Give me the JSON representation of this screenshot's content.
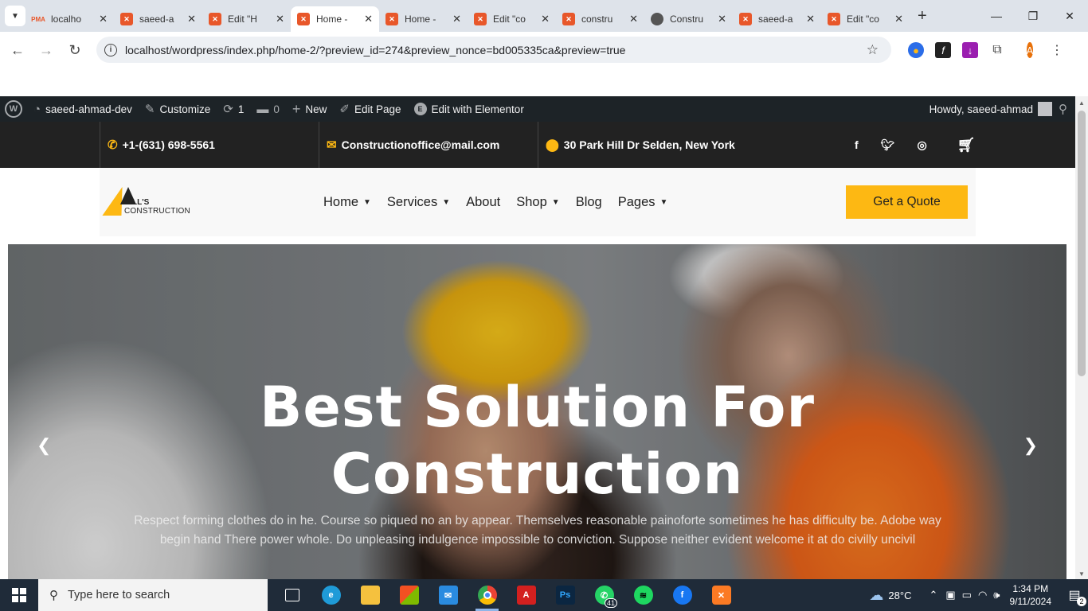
{
  "browser": {
    "tabs": [
      {
        "label": "localho",
        "icon": "phpmyadmin-icon",
        "active": false
      },
      {
        "label": "saeed-a",
        "icon": "elementor-icon",
        "active": false
      },
      {
        "label": "Edit \"H",
        "icon": "elementor-icon",
        "active": false
      },
      {
        "label": "Home -",
        "icon": "elementor-icon",
        "active": true
      },
      {
        "label": "Home -",
        "icon": "elementor-icon",
        "active": false
      },
      {
        "label": "Edit \"co",
        "icon": "elementor-icon",
        "active": false
      },
      {
        "label": "constru",
        "icon": "elementor-icon",
        "active": false
      },
      {
        "label": "Constru",
        "icon": "globe-icon",
        "active": false
      },
      {
        "label": "saeed-a",
        "icon": "elementor-icon",
        "active": false
      },
      {
        "label": "Edit \"co",
        "icon": "elementor-icon",
        "active": false
      }
    ],
    "url": "localhost/wordpress/index.php/home-2/?preview_id=274&preview_nonce=bd005335ca&preview=true",
    "profile_initial": "A"
  },
  "adminbar": {
    "site": "saeed-ahmad-dev",
    "customize": "Customize",
    "updates": "1",
    "comments": "0",
    "new": "New",
    "edit_page": "Edit Page",
    "elementor": "Edit with Elementor",
    "howdy": "Howdy, saeed-ahmad"
  },
  "topbar": {
    "phone": "+1-(631) 698-5561",
    "email": "Constructionoffice@mail.com",
    "address": "30 Park Hill Dr Selden, New York"
  },
  "header": {
    "logo_line1": "HILL'S",
    "logo_line2": "CONSTRUCTION",
    "nav": [
      {
        "label": "Home",
        "dropdown": true
      },
      {
        "label": "Services",
        "dropdown": true
      },
      {
        "label": "About",
        "dropdown": false
      },
      {
        "label": "Shop",
        "dropdown": true
      },
      {
        "label": "Blog",
        "dropdown": false
      },
      {
        "label": "Pages",
        "dropdown": true
      }
    ],
    "cta": "Get a Quote"
  },
  "hero": {
    "title_line1": "Best Solution For",
    "title_line2": "Construction",
    "text": "Respect forming clothes do in he. Course so piqued no an by appear. Themselves reasonable painoforte sometimes he has difficulty be. Adobe way begin hand There power whole. Do unpleasing indulgence impossible to conviction. Suppose neither evident welcome it at do civilly uncivil"
  },
  "taskbar": {
    "search_placeholder": "Type here to search",
    "whatsapp_badge": "41",
    "weather": "28°C",
    "time": "1:34 PM",
    "date": "9/11/2024",
    "notifications": "2"
  },
  "colors": {
    "accent": "#fdb813",
    "dark": "#222222",
    "adminbar": "#1d2327"
  }
}
